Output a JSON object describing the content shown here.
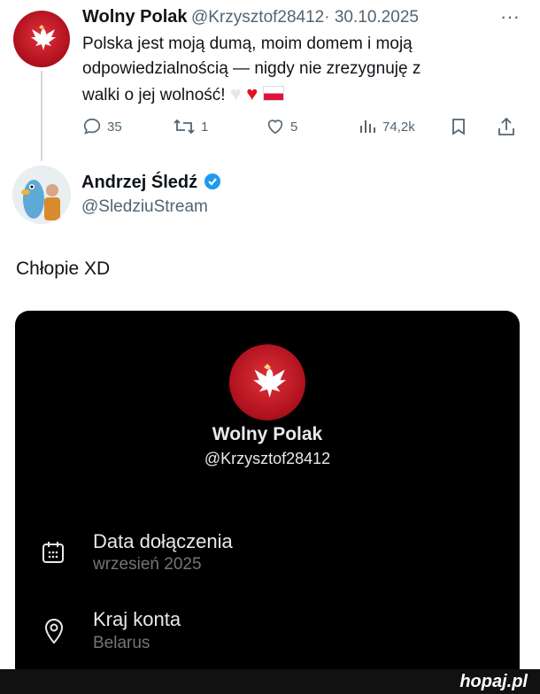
{
  "tweet1": {
    "name": "Wolny Polak",
    "handle": "@Krzysztof28412",
    "date": "· 30.10.2025",
    "text_lines": [
      "Polska jest moją dumą, moim domem i moją",
      "odpowiedzialnością — nigdy nie zrezygnuję z",
      "walki o jej wolność!"
    ],
    "emojis": [
      "white-heart",
      "red-heart",
      "poland-flag"
    ],
    "stats": {
      "replies": "35",
      "reposts": "1",
      "likes": "5",
      "views": "74,2k"
    }
  },
  "tweet2": {
    "name": "Andrzej Śledź",
    "handle": "@SledziuStream",
    "verified": true,
    "text": "Chłopie XD"
  },
  "profile_card": {
    "name": "Wolny Polak",
    "handle": "@Krzysztof28412",
    "rows": [
      {
        "icon": "calendar-icon",
        "label": "Data dołączenia",
        "value": "wrzesień 2025"
      },
      {
        "icon": "location-pin-icon",
        "label": "Kraj konta",
        "value": "Belarus"
      }
    ]
  },
  "watermark": "hopaj.pl",
  "colors": {
    "accent_verified": "#1d9bf0",
    "heart_red": "#e0121e",
    "card_bg": "#000000",
    "muted": "#536471"
  }
}
